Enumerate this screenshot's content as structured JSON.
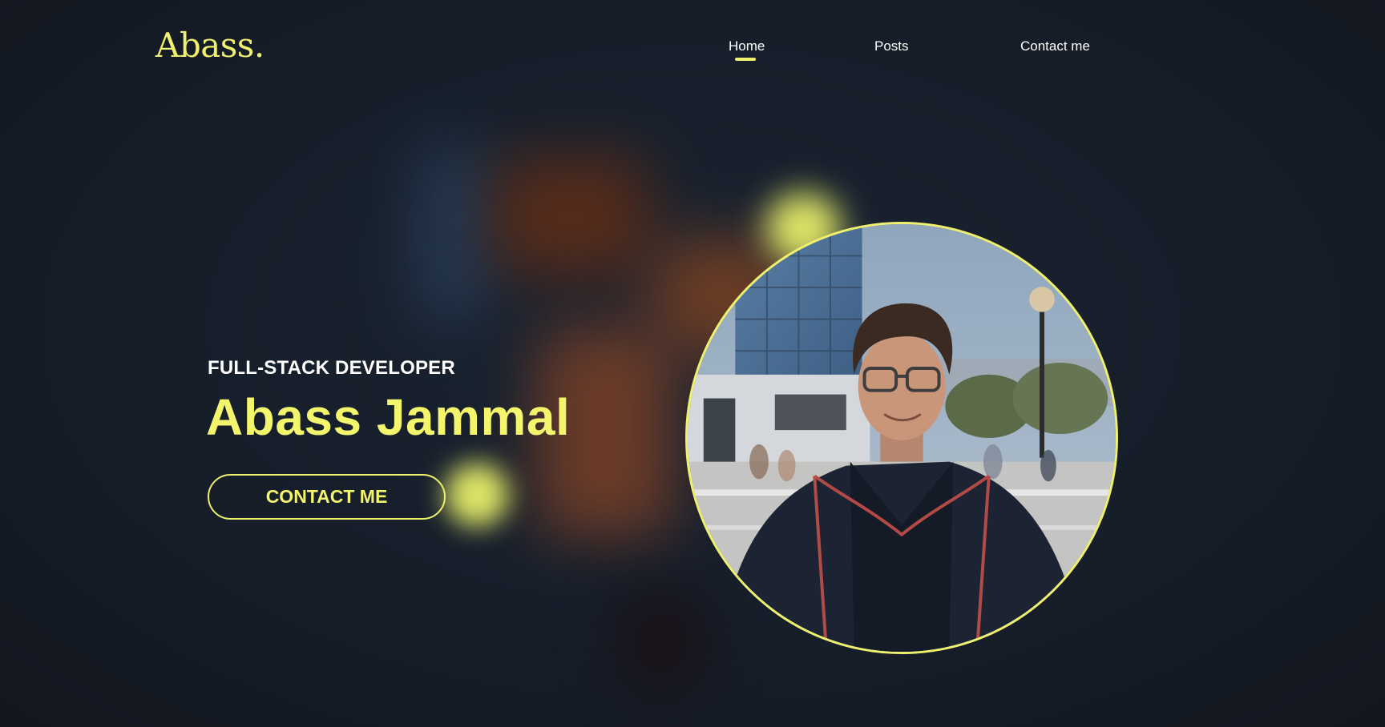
{
  "header": {
    "logo": "Abass.",
    "nav": [
      {
        "label": "Home",
        "active": true
      },
      {
        "label": "Posts",
        "active": false
      },
      {
        "label": "Contact me",
        "active": false
      }
    ]
  },
  "hero": {
    "role": "FULL-STACK DEVELOPER",
    "name": "Abass Jammal",
    "cta_label": "CONTACT ME"
  },
  "colors": {
    "accent": "#eef06e",
    "background": "#151d29",
    "text": "#ffffff"
  }
}
